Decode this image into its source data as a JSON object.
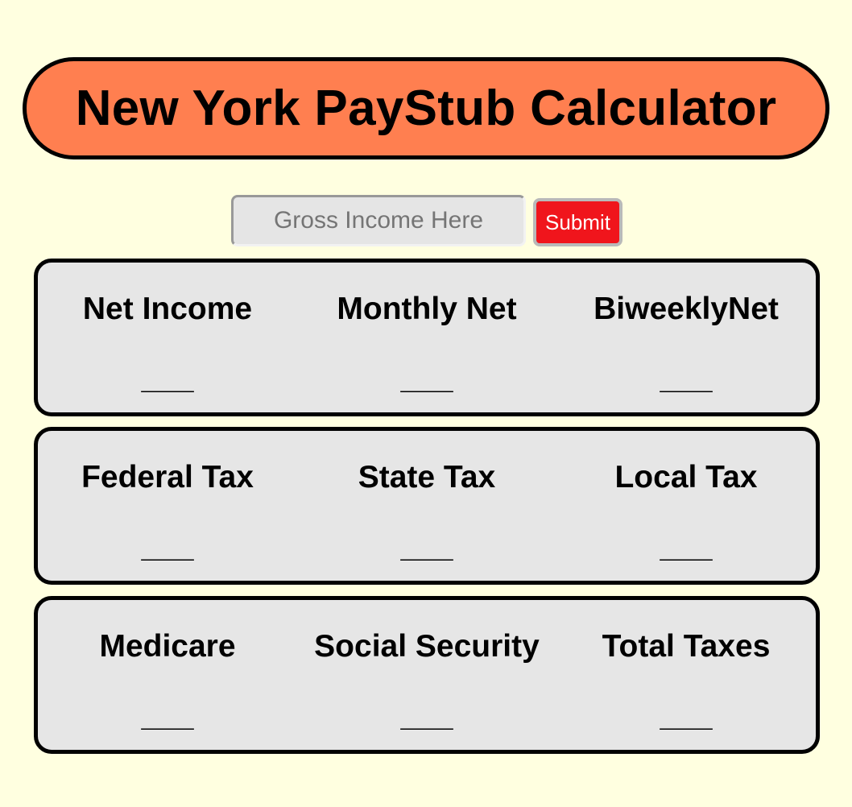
{
  "header": {
    "title": "New York PayStub Calculator",
    "banner_color": "#ff7f50"
  },
  "form": {
    "income_placeholder": "Gross Income Here",
    "income_value": "",
    "submit_label": "Submit",
    "submit_color": "#f0151c"
  },
  "panels": [
    {
      "cells": [
        {
          "label": "Net Income",
          "value": "___"
        },
        {
          "label": "Monthly Net",
          "value": "___"
        },
        {
          "label": "BiweeklyNet",
          "value": "___"
        }
      ]
    },
    {
      "cells": [
        {
          "label": "Federal Tax",
          "value": "___"
        },
        {
          "label": "State Tax",
          "value": "___"
        },
        {
          "label": "Local Tax",
          "value": "___"
        }
      ]
    },
    {
      "cells": [
        {
          "label": "Medicare",
          "value": "___"
        },
        {
          "label": "Social Security",
          "value": "___"
        },
        {
          "label": "Total Taxes",
          "value": "___"
        }
      ]
    }
  ]
}
